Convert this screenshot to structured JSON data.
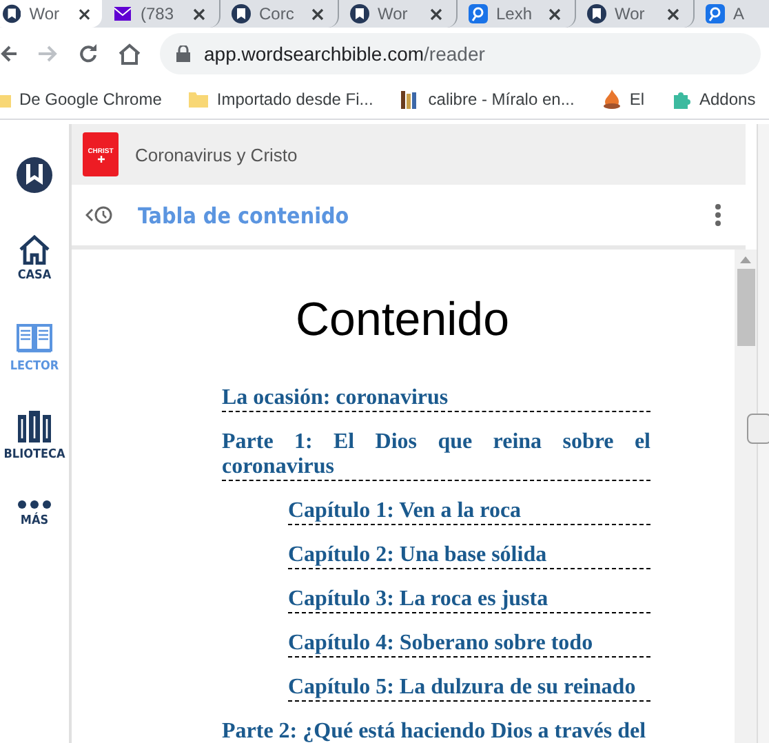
{
  "browser_tabs": [
    {
      "title": "Wor",
      "kind": "w",
      "selected": true
    },
    {
      "title": "(783",
      "kind": "mail",
      "selected": false
    },
    {
      "title": "Corc",
      "kind": "w",
      "selected": false
    },
    {
      "title": "Wor",
      "kind": "w",
      "selected": false
    },
    {
      "title": "Lexh",
      "kind": "search",
      "selected": false
    },
    {
      "title": "Wor",
      "kind": "w",
      "selected": false
    },
    {
      "title": "A",
      "kind": "search",
      "selected": false
    }
  ],
  "address": {
    "host": "app.wordsearchbible.com",
    "path": "/reader"
  },
  "bookmarks": [
    {
      "label": "De Google Chrome",
      "kind": "folder"
    },
    {
      "label": "Importado desde Fi...",
      "kind": "folder"
    },
    {
      "label": "calibre - Míralo en...",
      "kind": "books"
    },
    {
      "label": "El",
      "kind": "flame"
    },
    {
      "label": "Addons",
      "kind": "puzzle"
    }
  ],
  "sidebar": [
    {
      "label": "CASA",
      "kind": "home",
      "selected": false
    },
    {
      "label": "LECTOR",
      "kind": "book",
      "selected": true
    },
    {
      "label": "BLIOTECA",
      "kind": "library",
      "selected": false
    },
    {
      "label": "MÁS",
      "kind": "more",
      "selected": false
    }
  ],
  "book": {
    "cover": "CHRIST",
    "title": "Coronavirus y Cristo"
  },
  "toc_header": "Tabla de contenido",
  "heading": "Contenido",
  "toc": [
    {
      "label": "La ocasión: coronavirus"
    },
    {
      "label": "Parte 1: El Dios que reina sobre el coronavirus",
      "children": [
        {
          "label": "Capítulo 1: Ven a la roca"
        },
        {
          "label": "Capítulo 2: Una base sólida"
        },
        {
          "label": "Capítulo 3: La roca es justa"
        },
        {
          "label": "Capítulo 4: Soberano sobre todo"
        },
        {
          "label": "Capítulo 5: La dulzura de su reinado"
        }
      ]
    },
    {
      "label": "Parte 2: ¿Qué está haciendo Dios a través del"
    }
  ]
}
